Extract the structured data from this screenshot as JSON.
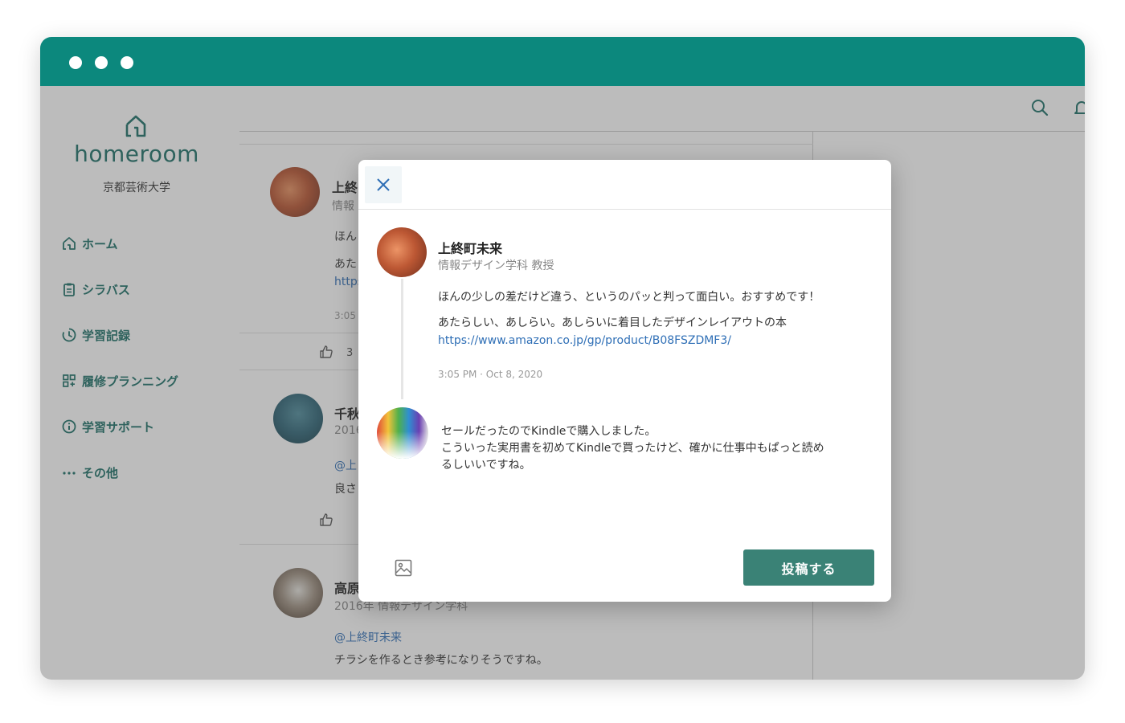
{
  "app": {
    "name": "homeroom",
    "school": "京都芸術大学",
    "colors": {
      "brand": "#0c887d",
      "nav_text": "#1b6f66",
      "button": "#3a8276",
      "link": "#2f6fb6"
    }
  },
  "sidebar": {
    "items": [
      {
        "label": "ホーム",
        "icon": "home-icon"
      },
      {
        "label": "シラバス",
        "icon": "clipboard-icon"
      },
      {
        "label": "学習記録",
        "icon": "history-icon"
      },
      {
        "label": "履修プランニング",
        "icon": "grid-icon"
      },
      {
        "label": "学習サポート",
        "icon": "info-icon"
      },
      {
        "label": "その他",
        "icon": "more-icon"
      }
    ]
  },
  "topbar": {
    "icons": [
      "search-icon",
      "bell-icon"
    ]
  },
  "feed": {
    "posts": [
      {
        "author_partial": "上終",
        "meta_partial": "情報",
        "line1_partial": "ほん",
        "line2_partial": "あた",
        "link_partial": "https",
        "time_partial": "3:05",
        "likes": "3"
      },
      {
        "author_partial": "千秋",
        "meta_partial": "2016",
        "mention_partial": "@上",
        "text_partial": "良さ"
      },
      {
        "author_partial": "高原",
        "meta": "2016年 情報デザイン学科",
        "mention": "@上終町未来",
        "text": "チラシを作るとき参考になりそうですね。"
      }
    ]
  },
  "modal": {
    "close_icon": "close-icon",
    "post": {
      "author": "上終町未来",
      "meta": "情報デザイン学科 教授",
      "line1": "ほんの少しの差だけど違う、というのパッと判って面白い。おすすめです！",
      "line2": "あたらしい、あしらい。あしらいに着目したデザインレイアウトの本",
      "link": "https://www.amazon.co.jp/gp/product/B08FSZDMF3/",
      "timestamp": "3:05 PM · Oct 8, 2020"
    },
    "reply": {
      "line1": "セールだったのでKindleで購入しました。",
      "line2": "こういった実用書を初めてKindleで買ったけど、確かに仕事中もぱっと読め",
      "line3": "るしいいですね。"
    },
    "post_button": "投稿する",
    "image_icon": "image-icon"
  }
}
